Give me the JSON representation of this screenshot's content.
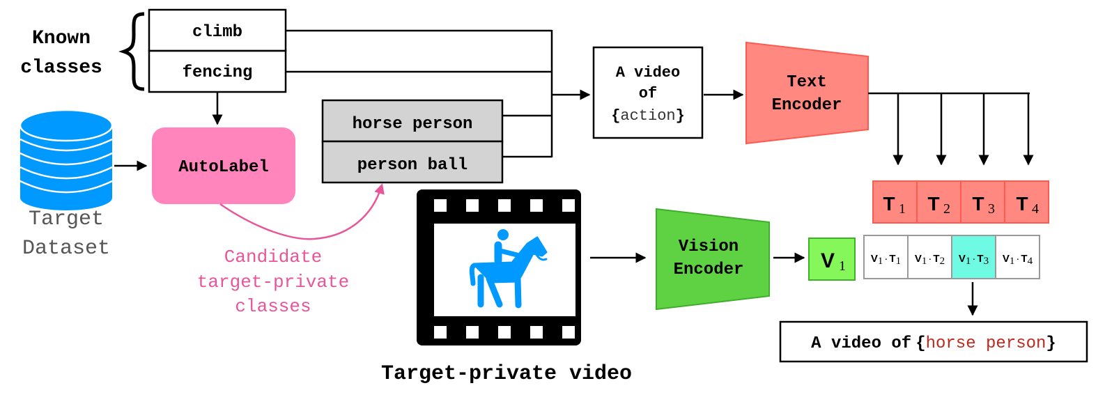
{
  "known_classes": {
    "label_line1": "Known",
    "label_line2": "classes",
    "items": [
      "climb",
      "fencing"
    ]
  },
  "target_dataset": {
    "label_line1": "Target",
    "label_line2": "Dataset",
    "icon": "database-icon"
  },
  "autolabel": {
    "label": "AutoLabel"
  },
  "candidate_classes": {
    "items": [
      "horse person",
      "person ball"
    ],
    "caption_line1": "Candidate",
    "caption_line2": "target-private",
    "caption_line3": "classes"
  },
  "prompt_template": {
    "line1": "A video",
    "line2": "of",
    "open_brace": "{",
    "placeholder": "action",
    "close_brace": "}"
  },
  "text_encoder": {
    "line1": "Text",
    "line2": "Encoder"
  },
  "text_embeddings": [
    {
      "symbol": "T",
      "sub": "1"
    },
    {
      "symbol": "T",
      "sub": "2"
    },
    {
      "symbol": "T",
      "sub": "3"
    },
    {
      "symbol": "T",
      "sub": "4"
    }
  ],
  "video": {
    "caption": "Target-private video",
    "icon": "horse-rider-icon"
  },
  "vision_encoder": {
    "line1": "Vision",
    "line2": "Encoder"
  },
  "vision_embedding": {
    "symbol": "V",
    "sub": "1"
  },
  "similarities": [
    {
      "v": "V",
      "vsub": "1",
      "dot": "·",
      "t": "T",
      "tsub": "1",
      "highlight": false
    },
    {
      "v": "V",
      "vsub": "1",
      "dot": "·",
      "t": "T",
      "tsub": "2",
      "highlight": false
    },
    {
      "v": "V",
      "vsub": "1",
      "dot": "·",
      "t": "T",
      "tsub": "3",
      "highlight": true
    },
    {
      "v": "V",
      "vsub": "1",
      "dot": "·",
      "t": "T",
      "tsub": "4",
      "highlight": false
    }
  ],
  "result": {
    "prefix": "A video of",
    "open_brace": "{",
    "value": "horse person",
    "close_brace": "}"
  },
  "colors": {
    "database_blue": "#0099ff",
    "autolabel_pink": "#ff85bc",
    "candidate_pink": "#e8559a",
    "candidate_gray": "#d3d3d3",
    "text_encoder_red": "#ff8880",
    "text_encoder_border": "#ff5a4f",
    "vision_green": "#5ed243",
    "vision_border": "#3fae2a",
    "v1_green": "#86f75a",
    "highlight_cyan": "#6ffbe3",
    "result_red": "#c0281e"
  }
}
